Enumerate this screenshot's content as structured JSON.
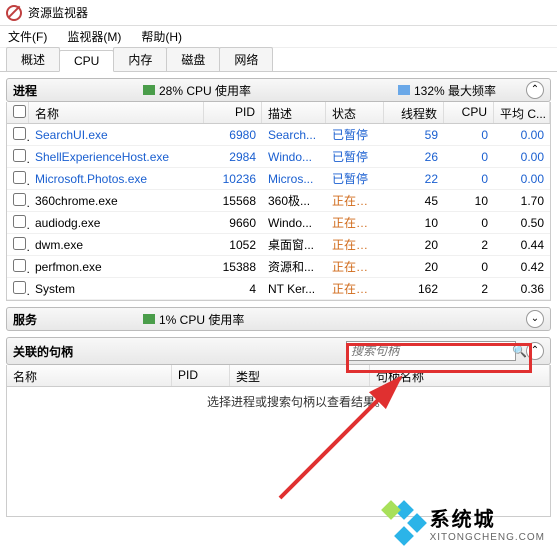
{
  "window": {
    "title": "资源监视器"
  },
  "menu": {
    "file": "文件(F)",
    "monitor": "监视器(M)",
    "help": "帮助(H)"
  },
  "tabs": {
    "overview": "概述",
    "cpu": "CPU",
    "memory": "内存",
    "disk": "磁盘",
    "network": "网络"
  },
  "proc_section": {
    "title": "进程",
    "cpu_usage": "28% CPU 使用率",
    "max_freq": "132% 最大频率"
  },
  "cols": {
    "name": "名称",
    "pid": "PID",
    "desc": "描述",
    "status": "状态",
    "threads": "线程数",
    "cpu": "CPU",
    "avg": "平均 C..."
  },
  "rows": [
    {
      "name": "SearchUI.exe",
      "pid": "6980",
      "desc": "Search...",
      "status": "已暂停",
      "threads": "59",
      "cpu": "0",
      "avg": "0.00",
      "link": true
    },
    {
      "name": "ShellExperienceHost.exe",
      "pid": "2984",
      "desc": "Windo...",
      "status": "已暂停",
      "threads": "26",
      "cpu": "0",
      "avg": "0.00",
      "link": true
    },
    {
      "name": "Microsoft.Photos.exe",
      "pid": "10236",
      "desc": "Micros...",
      "status": "已暂停",
      "threads": "22",
      "cpu": "0",
      "avg": "0.00",
      "link": true
    },
    {
      "name": "360chrome.exe",
      "pid": "15568",
      "desc": "360极...",
      "status": "正在运行",
      "threads": "45",
      "cpu": "10",
      "avg": "1.70",
      "link": false
    },
    {
      "name": "audiodg.exe",
      "pid": "9660",
      "desc": "Windo...",
      "status": "正在运行",
      "threads": "10",
      "cpu": "0",
      "avg": "0.50",
      "link": false
    },
    {
      "name": "dwm.exe",
      "pid": "1052",
      "desc": "桌面窗...",
      "status": "正在运行",
      "threads": "20",
      "cpu": "2",
      "avg": "0.44",
      "link": false
    },
    {
      "name": "perfmon.exe",
      "pid": "15388",
      "desc": "资源和...",
      "status": "正在运行",
      "threads": "20",
      "cpu": "0",
      "avg": "0.42",
      "link": false
    },
    {
      "name": "System",
      "pid": "4",
      "desc": "NT Ker...",
      "status": "正在运行",
      "threads": "162",
      "cpu": "2",
      "avg": "0.36",
      "link": false
    }
  ],
  "svc_section": {
    "title": "服务",
    "cpu_usage": "1% CPU 使用率"
  },
  "handles_section": {
    "title": "关联的句柄",
    "placeholder": "搜索句柄"
  },
  "hcols": {
    "name": "名称",
    "pid": "PID",
    "type": "类型",
    "hname": "句柄名称"
  },
  "handles_empty": "选择进程或搜索句柄以查看结果。",
  "watermark": {
    "cn": "系统城",
    "en": "XITONGCHENG.COM"
  }
}
